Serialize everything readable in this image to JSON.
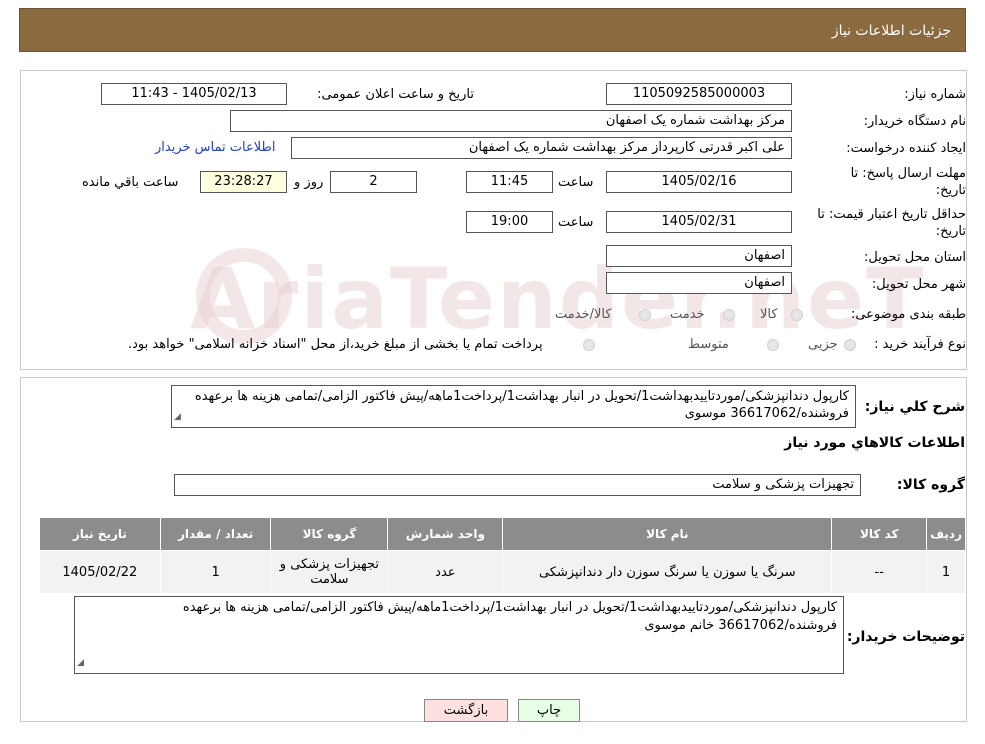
{
  "header": {
    "title": "جزئیات اطلاعات نیاز"
  },
  "form": {
    "need_number": {
      "label": "شماره نیاز:",
      "value": "1105092585000003"
    },
    "announce": {
      "label": "تاریخ و ساعت اعلان عمومی:",
      "value": "1405/02/13 - 11:43"
    },
    "buyer_org": {
      "label": "نام دستگاه خریدار:",
      "value": "مرکز بهداشت شماره یک اصفهان"
    },
    "requester": {
      "label": "ایجاد کننده درخواست:",
      "value": "علی اکبر قدرتی کارپرداز مرکز بهداشت شماره یک اصفهان",
      "contact_link": "اطلاعات تماس خریدار"
    },
    "reply_deadline": {
      "label_line1": "مهلت ارسال پاسخ: تا",
      "label_line2": "تاریخ:",
      "date": "1405/02/16",
      "time_label": "ساعت",
      "time": "11:45",
      "days": "2",
      "days_label": "روز و",
      "remaining": "23:28:27",
      "remaining_label": "ساعت باقي مانده"
    },
    "price_validity": {
      "label_line1": "حداقل تاریخ اعتبار قیمت: تا",
      "label_line2": "تاریخ:",
      "date": "1405/02/31",
      "time_label": "ساعت",
      "time": "19:00"
    },
    "province": {
      "label": "استان محل تحویل:",
      "value": "اصفهان"
    },
    "city": {
      "label": "شهر محل تحویل:",
      "value": "اصفهان"
    },
    "category": {
      "label": "طبقه بندی موضوعی:",
      "options": [
        "کالا",
        "خدمت",
        "کالا/خدمت"
      ]
    },
    "process": {
      "label": "نوع فرآیند خرید :",
      "options": [
        "جزیی",
        "متوسط"
      ],
      "note": "پرداخت تمام یا بخشی از مبلغ خرید،از محل \"اسناد خزانه اسلامی\" خواهد بود."
    }
  },
  "description": {
    "label": "شرح کلي نياز:",
    "text": "کارپول دندانپزشکی/موردتاییدبهداشت1/تحویل در انبار بهداشت1/پرداخت1ماهه/پیش فاکتور الزامی/تمامی هزینه ها برعهده فروشنده/36617062 موسوی"
  },
  "items_section": {
    "title": "اطلاعات کالاهاي مورد نياز",
    "group_label": "گروه کالا:",
    "group_value": "تجهیزات پزشکی و سلامت"
  },
  "table": {
    "headers": [
      "ردیف",
      "کد کالا",
      "نام کالا",
      "واحد شمارش",
      "گروه کالا",
      "تعداد / مقدار",
      "تاریخ نیاز"
    ],
    "rows": [
      [
        "1",
        "--",
        "سرنگ یا سوزن یا سرنگ سوزن دار دندانپزشکی",
        "عدد",
        "تجهیزات پزشکی و سلامت",
        "1",
        "1405/02/22"
      ]
    ]
  },
  "buyer_notes": {
    "label": "توضیحات خریدار:",
    "text": "کارپول دندانپزشکی/موردتاییدبهداشت1/تحویل در انبار بهداشت1/پرداخت1ماهه/پیش فاکتور الزامی/تمامی هزینه ها برعهده فروشنده/36617062 خانم موسوی"
  },
  "buttons": {
    "print": "چاپ",
    "back": "بازگشت"
  },
  "watermark": "AriaTender.neT",
  "colors": {
    "header": "#8c6a3f",
    "table_header": "#8c8c8c",
    "link": "#1f3fbf",
    "back_button": "#ffe0e0",
    "print_button": "#e6ffe6"
  }
}
